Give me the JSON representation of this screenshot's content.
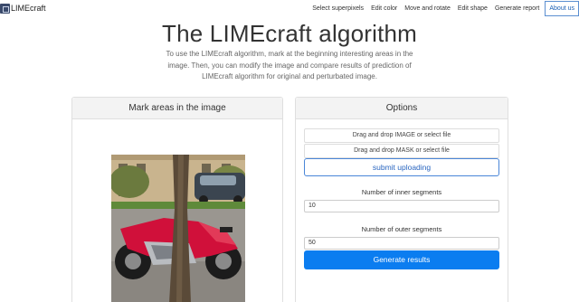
{
  "navbar": {
    "brand": "LIMEcraft",
    "links": [
      "Select superpixels",
      "Edit color",
      "Move and rotate",
      "Edit shape",
      "Generate report",
      "About us"
    ]
  },
  "header": {
    "title": "The LIMEcraft algorithm",
    "intro": "To use the LIMEcraft algorithm, mark at the beginning interesting areas in the image. Then, you can modify the image and compare results of prediction of LIMEcraft algorithm for original and perturbated image."
  },
  "left_panel": {
    "title": "Mark areas in the image"
  },
  "options": {
    "title": "Options",
    "upload_image": "Drag and drop IMAGE or select file",
    "upload_mask": "Drag and drop MASK or select file",
    "submit": "submit uploading",
    "inner_label": "Number of inner segments",
    "inner_value": "10",
    "outer_label": "Number of outer segments",
    "outer_value": "50",
    "generate": "Generate results"
  },
  "colors": {
    "primary": "#0b7df0",
    "motorcycle": "#d0103a"
  }
}
